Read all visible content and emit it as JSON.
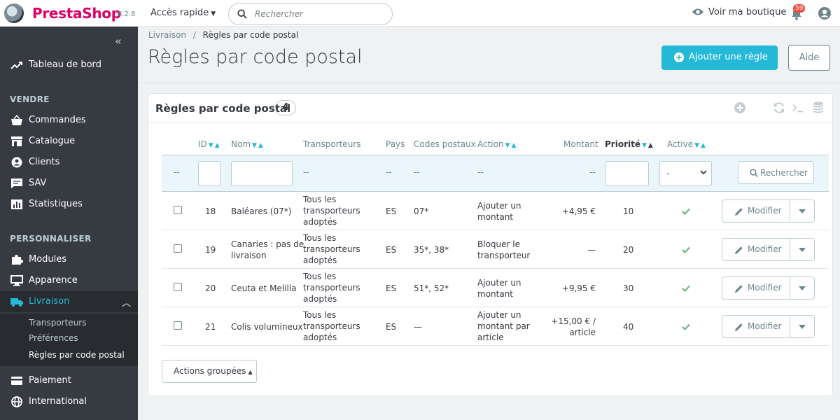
{
  "header": {
    "brand": "PrestaShop",
    "version": "8.2.8",
    "quick_access": "Accès rapide",
    "search_placeholder": "Rechercher",
    "view_shop": "Voir ma boutique",
    "notifications_count": "59"
  },
  "sidebar": {
    "collapse_icon": "double-chevron-left-icon",
    "dashboard": {
      "label": "Tableau de bord",
      "icon": "trending-up-icon"
    },
    "section_sell": "VENDRE",
    "sell_items": [
      {
        "label": "Commandes",
        "icon": "basket-icon"
      },
      {
        "label": "Catalogue",
        "icon": "store-icon"
      },
      {
        "label": "Clients",
        "icon": "user-circle-icon"
      },
      {
        "label": "SAV",
        "icon": "chat-icon"
      },
      {
        "label": "Statistiques",
        "icon": "bar-chart-icon"
      }
    ],
    "section_customize": "PERSONNALISER",
    "customize_items": [
      {
        "label": "Modules",
        "icon": "puzzle-icon"
      },
      {
        "label": "Apparence",
        "icon": "monitor-icon"
      },
      {
        "label": "Livraison",
        "icon": "truck-icon"
      }
    ],
    "shipping_subitems": [
      "Transporteurs",
      "Préférences",
      "Règles par code postal"
    ],
    "after_items": [
      {
        "label": "Paiement",
        "icon": "card-icon"
      },
      {
        "label": "International",
        "icon": "globe-icon"
      }
    ]
  },
  "breadcrumb": {
    "parent": "Livraison",
    "separator": "/",
    "current": "Règles par code postal"
  },
  "page": {
    "title": "Règles par code postal",
    "add_button": "Ajouter une règle",
    "help_button": "Aide"
  },
  "panel": {
    "title": "Règles par code postal",
    "count": "4",
    "columns": {
      "id": "ID",
      "name": "Nom",
      "carriers": "Transporteurs",
      "country": "Pays",
      "zip": "Codes postaux",
      "action": "Action",
      "amount": "Montant",
      "priority": "Priorité",
      "active": "Active"
    },
    "filter": {
      "dash": "--",
      "active_select": "-",
      "search_button": "Rechercher"
    },
    "rows": [
      {
        "id": "18",
        "name": [
          "Baléares (07*)"
        ],
        "carriers": [
          "Tous les",
          "transporteurs",
          "adoptés"
        ],
        "country": "ES",
        "zip": "07*",
        "action": [
          "Ajouter un",
          "montant"
        ],
        "amount": [
          "+4,95 €"
        ],
        "priority": "10",
        "edit": "Modifier"
      },
      {
        "id": "19",
        "name": [
          "Canaries : pas de",
          "livraison"
        ],
        "carriers": [
          "Tous les",
          "transporteurs",
          "adoptés"
        ],
        "country": "ES",
        "zip": "35*, 38*",
        "action": [
          "Bloquer le",
          "transporteur"
        ],
        "amount": [
          "—"
        ],
        "priority": "20",
        "edit": "Modifier"
      },
      {
        "id": "20",
        "name": [
          "Ceuta et Melilla"
        ],
        "carriers": [
          "Tous les",
          "transporteurs",
          "adoptés"
        ],
        "country": "ES",
        "zip": "51*, 52*",
        "action": [
          "Ajouter un",
          "montant"
        ],
        "amount": [
          "+9,95 €"
        ],
        "priority": "30",
        "edit": "Modifier"
      },
      {
        "id": "21",
        "name": [
          "Colis volumineux"
        ],
        "carriers": [
          "Tous les",
          "transporteurs",
          "adoptés"
        ],
        "country": "ES",
        "zip": "—",
        "action": [
          "Ajouter un",
          "montant par",
          "article"
        ],
        "amount": [
          "+15,00 € /",
          "article"
        ],
        "priority": "40",
        "edit": "Modifier"
      }
    ],
    "bulk_actions": "Actions groupées"
  },
  "colors": {
    "accent": "#25b9d7",
    "brand": "#df0067",
    "sidebar": "#363a41",
    "success": "#70b580"
  }
}
